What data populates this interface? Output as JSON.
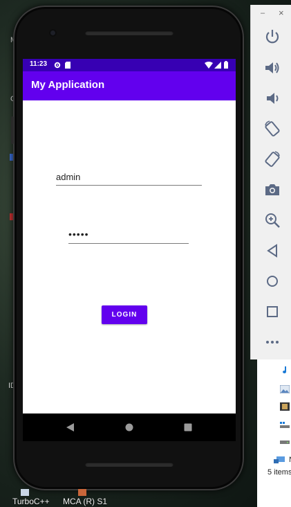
{
  "phone": {
    "status_time": "11:23",
    "app_title": "My Application",
    "username_value": "admin",
    "password_value": "•••••",
    "login_label": "LOGIN",
    "colors": {
      "status_bar": "#3700b3",
      "app_bar": "#6200ee",
      "button": "#6200ee"
    }
  },
  "emulator_toolbar": {
    "minimize_label": "–",
    "close_label": "×",
    "icons": [
      "power-icon",
      "volume-up-icon",
      "volume-down-icon",
      "rotate-left-icon",
      "rotate-right-icon",
      "camera-icon",
      "zoom-icon",
      "back-icon",
      "home-icon",
      "overview-icon",
      "more-icon"
    ]
  },
  "desktop": {
    "taskbar_items": [
      "TurboC++",
      "MCA (R) S1"
    ],
    "edge_text": [
      "M",
      "C",
      "ID"
    ],
    "explorer_items_text": "5 items",
    "explorer_edge_text": "N"
  }
}
